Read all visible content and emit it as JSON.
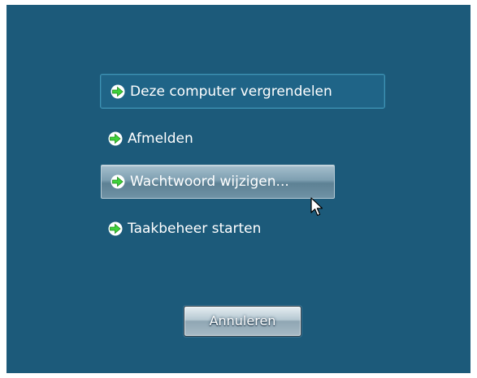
{
  "options": [
    {
      "label": "Deze computer vergrendelen",
      "icon": "green-arrow-icon"
    },
    {
      "label": "Afmelden",
      "icon": "green-arrow-icon"
    },
    {
      "label": "Wachtwoord wijzigen...",
      "icon": "green-arrow-icon"
    },
    {
      "label": "Taakbeheer starten",
      "icon": "green-arrow-icon"
    }
  ],
  "cancel_label": "Annuleren",
  "colors": {
    "background": "#1c5a7a",
    "arrow_fill": "#3fd13a",
    "text": "#ffffff"
  }
}
